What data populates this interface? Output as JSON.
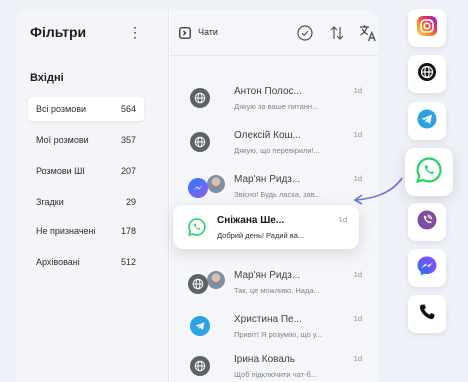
{
  "filters": {
    "title": "Фільтри",
    "section": "Вхідні",
    "items": [
      {
        "label": "Всі розмови",
        "count": "564"
      },
      {
        "label": "Мої розмови",
        "count": "357"
      },
      {
        "label": "Розмови ШІ",
        "count": "207"
      },
      {
        "label": "Згадки",
        "count": "29"
      },
      {
        "label": "Не призначені",
        "count": "178"
      },
      {
        "label": "Архівовані",
        "count": "512"
      }
    ]
  },
  "chats": {
    "title": "Чати",
    "items": [
      {
        "name": "Антон Полос...",
        "message": "Дякую за ваше питанн...",
        "time": "1d",
        "channel": "globe-icon"
      },
      {
        "name": "Олексій Кош...",
        "message": "Дякую, що перевірили!...",
        "time": "1d",
        "channel": "globe-icon"
      },
      {
        "name": "Мар'ян Ридз...",
        "message": "Звісно! Будь ласка, зав...",
        "time": "1d",
        "channel": "messenger-icon"
      },
      {
        "name": "Сніжана Ше...",
        "message": "Добрий день! Радий ва...",
        "time": "1d",
        "channel": "whatsapp-icon"
      },
      {
        "name": "Мар'ян Ридз...",
        "message": "Так, це можливо. Нада...",
        "time": "1d",
        "channel": "globe-icon"
      },
      {
        "name": "Христина Пе...",
        "message": "Привіт! Я розумію, що у...",
        "time": "1d",
        "channel": "telegram-icon"
      },
      {
        "name": "Ірина Коваль",
        "message": "Щоб підключити чат-б...",
        "time": "1d",
        "channel": "globe-icon"
      }
    ]
  },
  "channels": [
    "instagram-icon",
    "globe-icon",
    "telegram-icon",
    "whatsapp-icon",
    "viber-icon",
    "messenger-icon",
    "phone-icon"
  ],
  "colors": {
    "whatsapp": "#25d366",
    "telegram": "#2aa3e0",
    "viber": "#7f4da0",
    "messenger": "#1877f2",
    "arrow": "#6a73d6"
  }
}
